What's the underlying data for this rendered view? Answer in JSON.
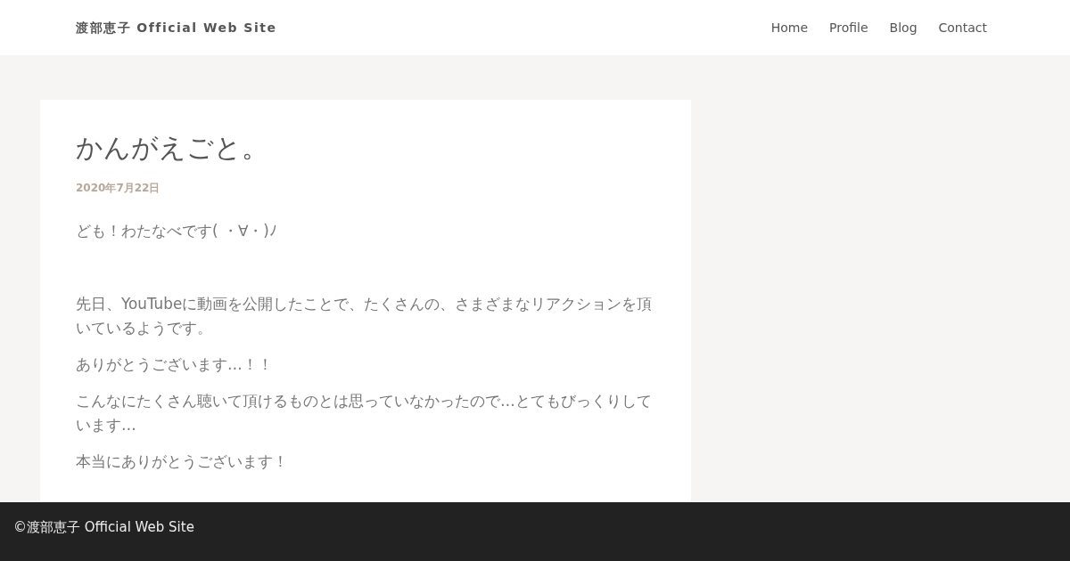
{
  "header": {
    "site_title": "渡部恵子 Official Web Site",
    "nav": [
      {
        "label": "Home"
      },
      {
        "label": "Profile"
      },
      {
        "label": "Blog"
      },
      {
        "label": "Contact"
      }
    ]
  },
  "post": {
    "title": "かんがえごと。",
    "date": "2020年7月22日",
    "sections": [
      {
        "paragraphs": [
          "ども！わたなべです( ・∀・)ﾉ"
        ]
      },
      {
        "paragraphs": [
          "先日、YouTubeに動画を公開したことで、たくさんの、さまざまなリアクションを頂いているようです。",
          "ありがとうございます…！！",
          "こんなにたくさん聴いて頂けるものとは思っていなかったので…とてもびっくりしています…",
          "本当にありがとうございます！"
        ]
      }
    ]
  },
  "footer": {
    "copyright": "©渡部恵子 Official Web Site"
  }
}
